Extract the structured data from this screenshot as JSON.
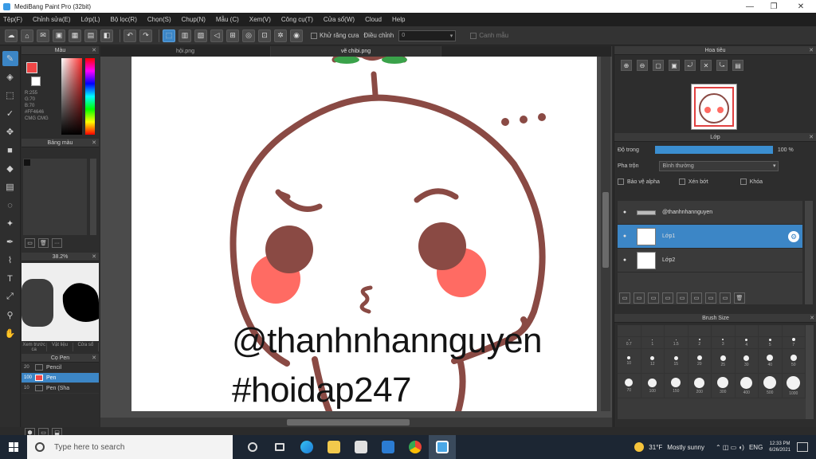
{
  "window": {
    "title": "MediBang Paint Pro (32bit)",
    "controls": [
      "—",
      "❐",
      "✕"
    ]
  },
  "menu": [
    "Tệp(F)",
    "Chỉnh sửa(E)",
    "Lớp(L)",
    "Bộ lọc(R)",
    "Chọn(S)",
    "Chụp(N)",
    "Mẫu (C)",
    "Xem(V)",
    "Công cụ(T)",
    "Cửa sổ(W)",
    "Cloud",
    "Help"
  ],
  "toolbar": {
    "auto_label": "Khử răng cưa",
    "correction_label": "Điều chỉnh",
    "correction_value": "0",
    "snap_label": "Canh mẫu"
  },
  "tools": {
    "brush": "✎",
    "eraser": "◈",
    "select": "⬚",
    "check": "✓",
    "move": "✥",
    "fill_rect": "■",
    "bucket": "◆",
    "gradient": "▤",
    "lasso": "◌",
    "magic": "✦",
    "pen": "✒",
    "dropper": "⌇",
    "text": "T",
    "transform": "⤢",
    "eyedrop": "⚲",
    "hand": "✋"
  },
  "color_panel": {
    "title": "Màu",
    "values": [
      "R:255",
      "G:70",
      "B:70",
      "#FF4646",
      "",
      "CMG  CMG"
    ]
  },
  "palette_panel": {
    "title": "Bảng màu",
    "btns": [
      "▭",
      "🗑",
      "···"
    ]
  },
  "preview_panel": {
    "zoom": "38.2%",
    "tabs": [
      "Xem trước ca",
      "Vật liệu",
      "Cửa sổ"
    ]
  },
  "brush_panel": {
    "title": "Cọ Pen",
    "items": [
      {
        "size": "20",
        "name": "Pencil",
        "selected": false
      },
      {
        "size": "100",
        "name": "Pen",
        "selected": true
      },
      {
        "size": "10",
        "name": "Pen (Sha",
        "selected": false
      }
    ],
    "btns": [
      "⬢",
      "▭",
      "⬓"
    ]
  },
  "tabs": [
    "hội.png",
    "vẽ chibi.png",
    ""
  ],
  "canvas": {
    "watermark_1": "@thanhnhannguyen",
    "watermark_2": "#hoidap247",
    "line_color": "#8a4a44",
    "cheek_color": "#ff6b63",
    "stem_color": "#3aa24a"
  },
  "navigator": {
    "title": "Hoa tiêu",
    "buttons": [
      "⊕",
      "⊖",
      "▢",
      "▣",
      "⤾",
      "✕",
      "⤿",
      "▤"
    ]
  },
  "layer_panel": {
    "title": "Lớp",
    "opacity_label": "Độ trong",
    "opacity_value": "100 %",
    "blend_label": "Pha trộn",
    "blend_value": "Bình thường",
    "protect_alpha": "Bảo vệ alpha",
    "clipping": "Xén bớt",
    "lock": "Khóa",
    "layers": [
      {
        "name": "@thanhnhannguyen",
        "selected": false,
        "thumb": "strip"
      },
      {
        "name": "Lớp1",
        "selected": true,
        "thumb": "img"
      },
      {
        "name": "Lớp2",
        "selected": false,
        "thumb": "img2"
      }
    ],
    "btns": [
      "▭",
      "▭",
      "▭",
      "▭",
      "▭",
      "▭",
      "▭",
      "▭",
      "🗑"
    ]
  },
  "brush_size": {
    "title": "Brush Size",
    "sizes": [
      "0.7",
      "1",
      "1.5",
      "2",
      "3",
      "4",
      "5",
      "7",
      "10",
      "12",
      "15",
      "20",
      "25",
      "30",
      "40",
      "50",
      "70",
      "100",
      "150",
      "200",
      "300",
      "400",
      "500",
      "1000"
    ],
    "fill": 100
  },
  "taskbar": {
    "search_placeholder": "Type here to search",
    "weather_temp": "31°F",
    "weather_desc": "Mostly sunny",
    "lang": "ENG",
    "time": "12:33 PM",
    "date": "6/26/2021"
  }
}
